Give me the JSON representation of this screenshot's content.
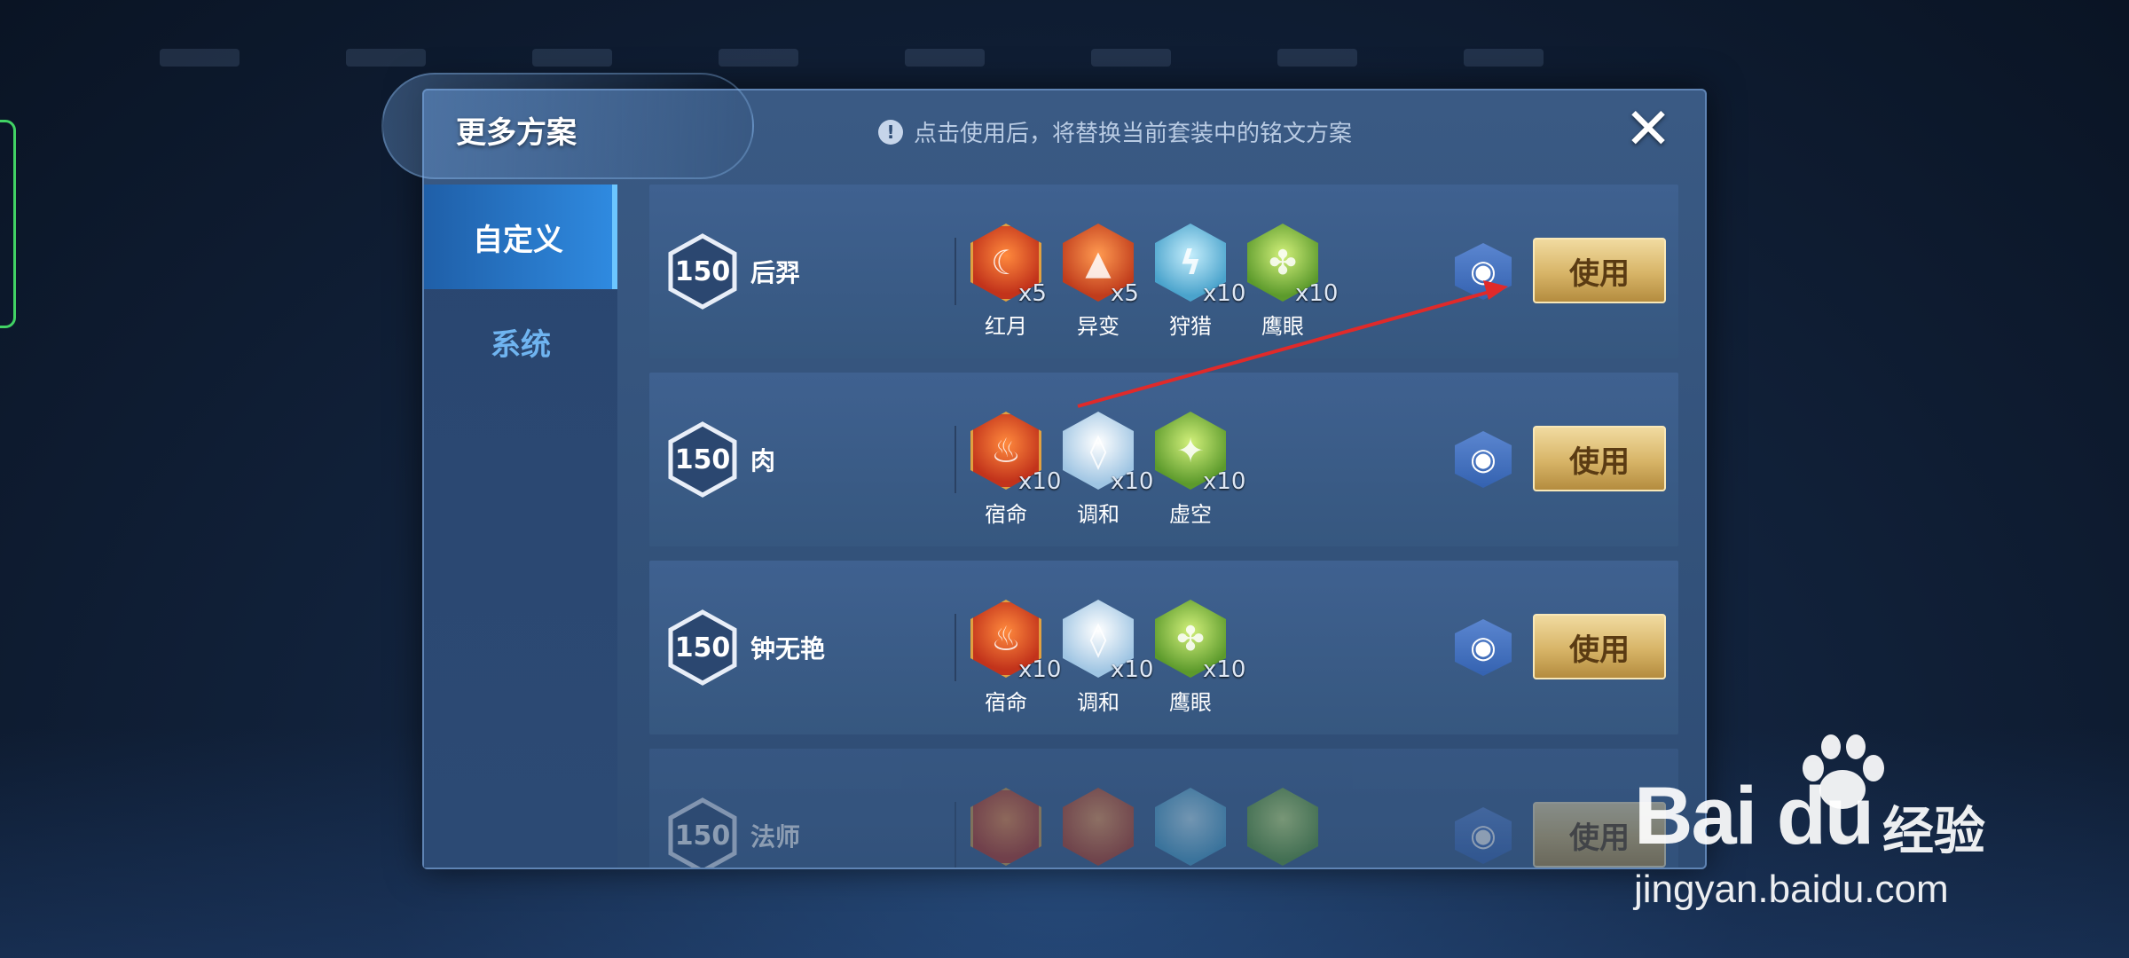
{
  "modal": {
    "title": "更多方案",
    "notice": "点击使用后，将替换当前套装中的铭文方案",
    "notice_icon": "!",
    "close_label": "✕"
  },
  "sidebar": {
    "tabs": [
      {
        "label": "自定义",
        "active": true
      },
      {
        "label": "系统",
        "active": false
      }
    ]
  },
  "schemes": [
    {
      "level": "150",
      "name": "后羿",
      "runes": [
        {
          "name": "红月",
          "count": "x5",
          "color": "red",
          "icon": "crescent-moon-icon"
        },
        {
          "name": "异变",
          "count": "x5",
          "color": "orange",
          "icon": "mutation-icon"
        },
        {
          "name": "狩猎",
          "count": "x10",
          "color": "blue",
          "icon": "hunt-icon"
        },
        {
          "name": "鹰眼",
          "count": "x10",
          "color": "green",
          "icon": "hawk-eye-icon"
        }
      ],
      "use_label": "使用"
    },
    {
      "level": "150",
      "name": "肉",
      "runes": [
        {
          "name": "宿命",
          "count": "x10",
          "color": "red",
          "icon": "fate-flame-icon"
        },
        {
          "name": "调和",
          "count": "x10",
          "color": "pale",
          "icon": "harmony-drop-icon"
        },
        {
          "name": "虚空",
          "count": "x10",
          "color": "green",
          "icon": "void-icon"
        }
      ],
      "use_label": "使用"
    },
    {
      "level": "150",
      "name": "钟无艳",
      "runes": [
        {
          "name": "宿命",
          "count": "x10",
          "color": "red",
          "icon": "fate-flame-icon"
        },
        {
          "name": "调和",
          "count": "x10",
          "color": "pale",
          "icon": "harmony-drop-icon"
        },
        {
          "name": "鹰眼",
          "count": "x10",
          "color": "green",
          "icon": "hawk-eye-icon"
        }
      ],
      "use_label": "使用"
    },
    {
      "level": "150",
      "name": "法师",
      "runes": [
        {
          "name": "",
          "count": "",
          "color": "red",
          "icon": "rune-icon"
        },
        {
          "name": "",
          "count": "",
          "color": "orange",
          "icon": "rune-icon"
        },
        {
          "name": "",
          "count": "",
          "color": "blue",
          "icon": "rune-icon"
        },
        {
          "name": "",
          "count": "",
          "color": "green",
          "icon": "rune-icon"
        }
      ],
      "use_label": "使用"
    }
  ],
  "watermark": {
    "logo": "Bai du",
    "brand_cn": "经验",
    "url": "jingyan.baidu.com"
  },
  "colors": {
    "accent_blue": "#2f8ae0",
    "use_button_gold": "#d7b467",
    "annotation_arrow": "#e02a2a"
  }
}
